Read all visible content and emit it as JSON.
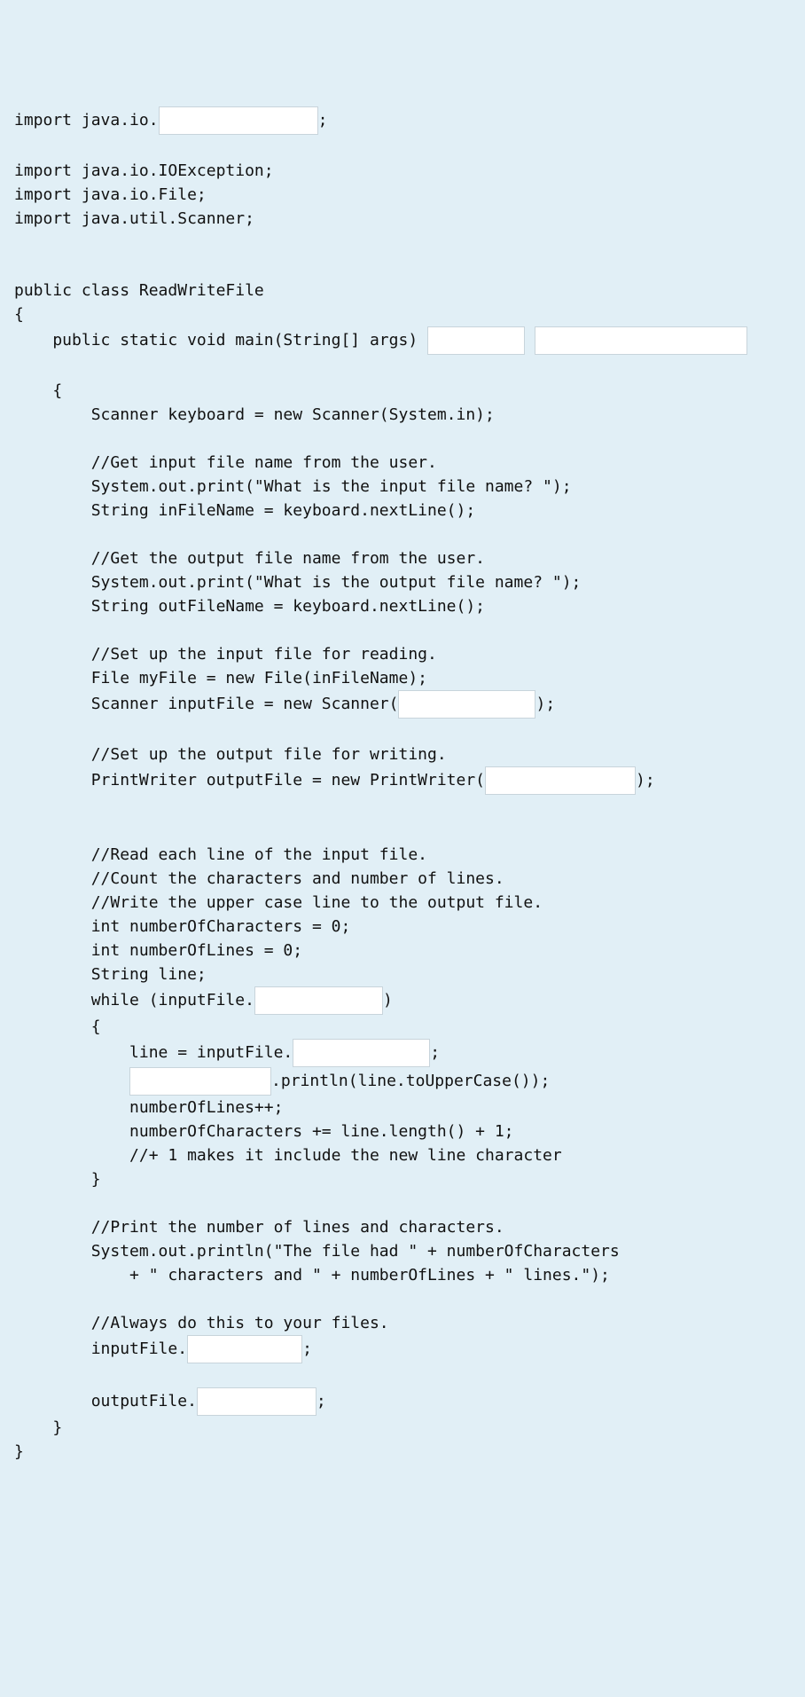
{
  "code": {
    "l01a": "import java.io.",
    "l01b": ";",
    "l02": "",
    "l03": "import java.io.IOException;",
    "l04": "import java.io.File;",
    "l05": "import java.util.Scanner;",
    "l06": "",
    "l07": "",
    "l08": "public class ReadWriteFile",
    "l09": "{",
    "l10a": "    public static void main(String[] args) ",
    "l10b": " ",
    "l11": "",
    "l12": "    {",
    "l13": "        Scanner keyboard = new Scanner(System.in);",
    "l14": "",
    "l15": "        //Get input file name from the user.",
    "l16": "        System.out.print(\"What is the input file name? \");",
    "l17": "        String inFileName = keyboard.nextLine();",
    "l18": "",
    "l19": "        //Get the output file name from the user.",
    "l20": "        System.out.print(\"What is the output file name? \");",
    "l21": "        String outFileName = keyboard.nextLine();",
    "l22": "",
    "l23": "        //Set up the input file for reading.",
    "l24": "        File myFile = new File(inFileName);",
    "l25a": "        Scanner inputFile = new Scanner(",
    "l25b": ");",
    "l26": "",
    "l27": "        //Set up the output file for writing.",
    "l28a": "        PrintWriter outputFile = new PrintWriter(",
    "l28b": ");",
    "l29": "",
    "l30": "",
    "l31": "        //Read each line of the input file.",
    "l32": "        //Count the characters and number of lines.",
    "l33": "        //Write the upper case line to the output file.",
    "l34": "        int numberOfCharacters = 0;",
    "l35": "        int numberOfLines = 0;",
    "l36": "        String line;",
    "l37a": "        while (inputFile.",
    "l37b": ")",
    "l38": "        {",
    "l39a": "            line = inputFile.",
    "l39b": ";",
    "l40a": "            ",
    "l40b": ".println(line.toUpperCase());",
    "l41": "            numberOfLines++;",
    "l42": "            numberOfCharacters += line.length() + 1;",
    "l43": "            //+ 1 makes it include the new line character",
    "l44": "        }",
    "l45": "",
    "l46": "        //Print the number of lines and characters.",
    "l47": "        System.out.println(\"The file had \" + numberOfCharacters",
    "l48": "            + \" characters and \" + numberOfLines + \" lines.\");",
    "l49": "",
    "l50": "        //Always do this to your files.",
    "l51a": "        inputFile.",
    "l51b": ";",
    "l52": "",
    "l53a": "        outputFile.",
    "l53b": ";",
    "l54": "    }",
    "l55": "}"
  },
  "blanks": {
    "b1": "",
    "b2": "",
    "b3": "",
    "b4": "",
    "b5": "",
    "b6": "",
    "b7": "",
    "b8": "",
    "b9": "",
    "b10": ""
  }
}
